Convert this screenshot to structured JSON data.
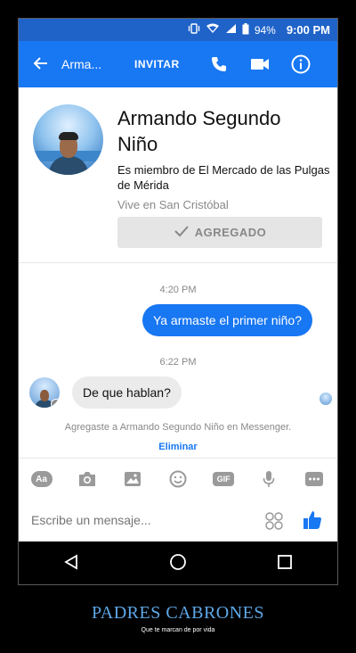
{
  "status_bar": {
    "battery": "94%",
    "time": "9:00 PM"
  },
  "header": {
    "contact_short": "Arma...",
    "invite_label": "INVITAR"
  },
  "profile": {
    "name": "Armando Segundo Niño",
    "membership": "Es miembro de El Mercado de las Pulgas de Mérida",
    "location": "Vive en San Cristóbal",
    "added_label": "AGREGADO"
  },
  "messages": [
    {
      "time": "4:20 PM",
      "text": "Ya armaste el primer niño?",
      "direction": "outgoing"
    },
    {
      "time": "6:22 PM",
      "text": "De que hablan?",
      "direction": "incoming"
    }
  ],
  "notice": {
    "text": "Agregaste a Armando Segundo Niño en Messenger.",
    "action": "Eliminar"
  },
  "toolbar": {
    "aa_label": "Aa",
    "gif_label": "GIF"
  },
  "composer": {
    "placeholder": "Escribe un mensaje..."
  },
  "caption": {
    "title": "PADRES CABRONES",
    "subtitle": "Que te marcan de por vida"
  },
  "colors": {
    "accent": "#1877f2",
    "status_bar": "#1f63c9",
    "caption": "#5fa7e6"
  },
  "icons": [
    "vibrate-icon",
    "wifi-icon",
    "signal-icon",
    "battery-icon",
    "back-arrow-icon",
    "phone-icon",
    "video-camera-icon",
    "info-icon",
    "check-icon",
    "camera-icon",
    "image-icon",
    "emoji-icon",
    "microphone-icon",
    "more-icon",
    "grid-icon",
    "thumbs-up-icon",
    "nav-back-icon",
    "nav-home-icon",
    "nav-recents-icon"
  ]
}
